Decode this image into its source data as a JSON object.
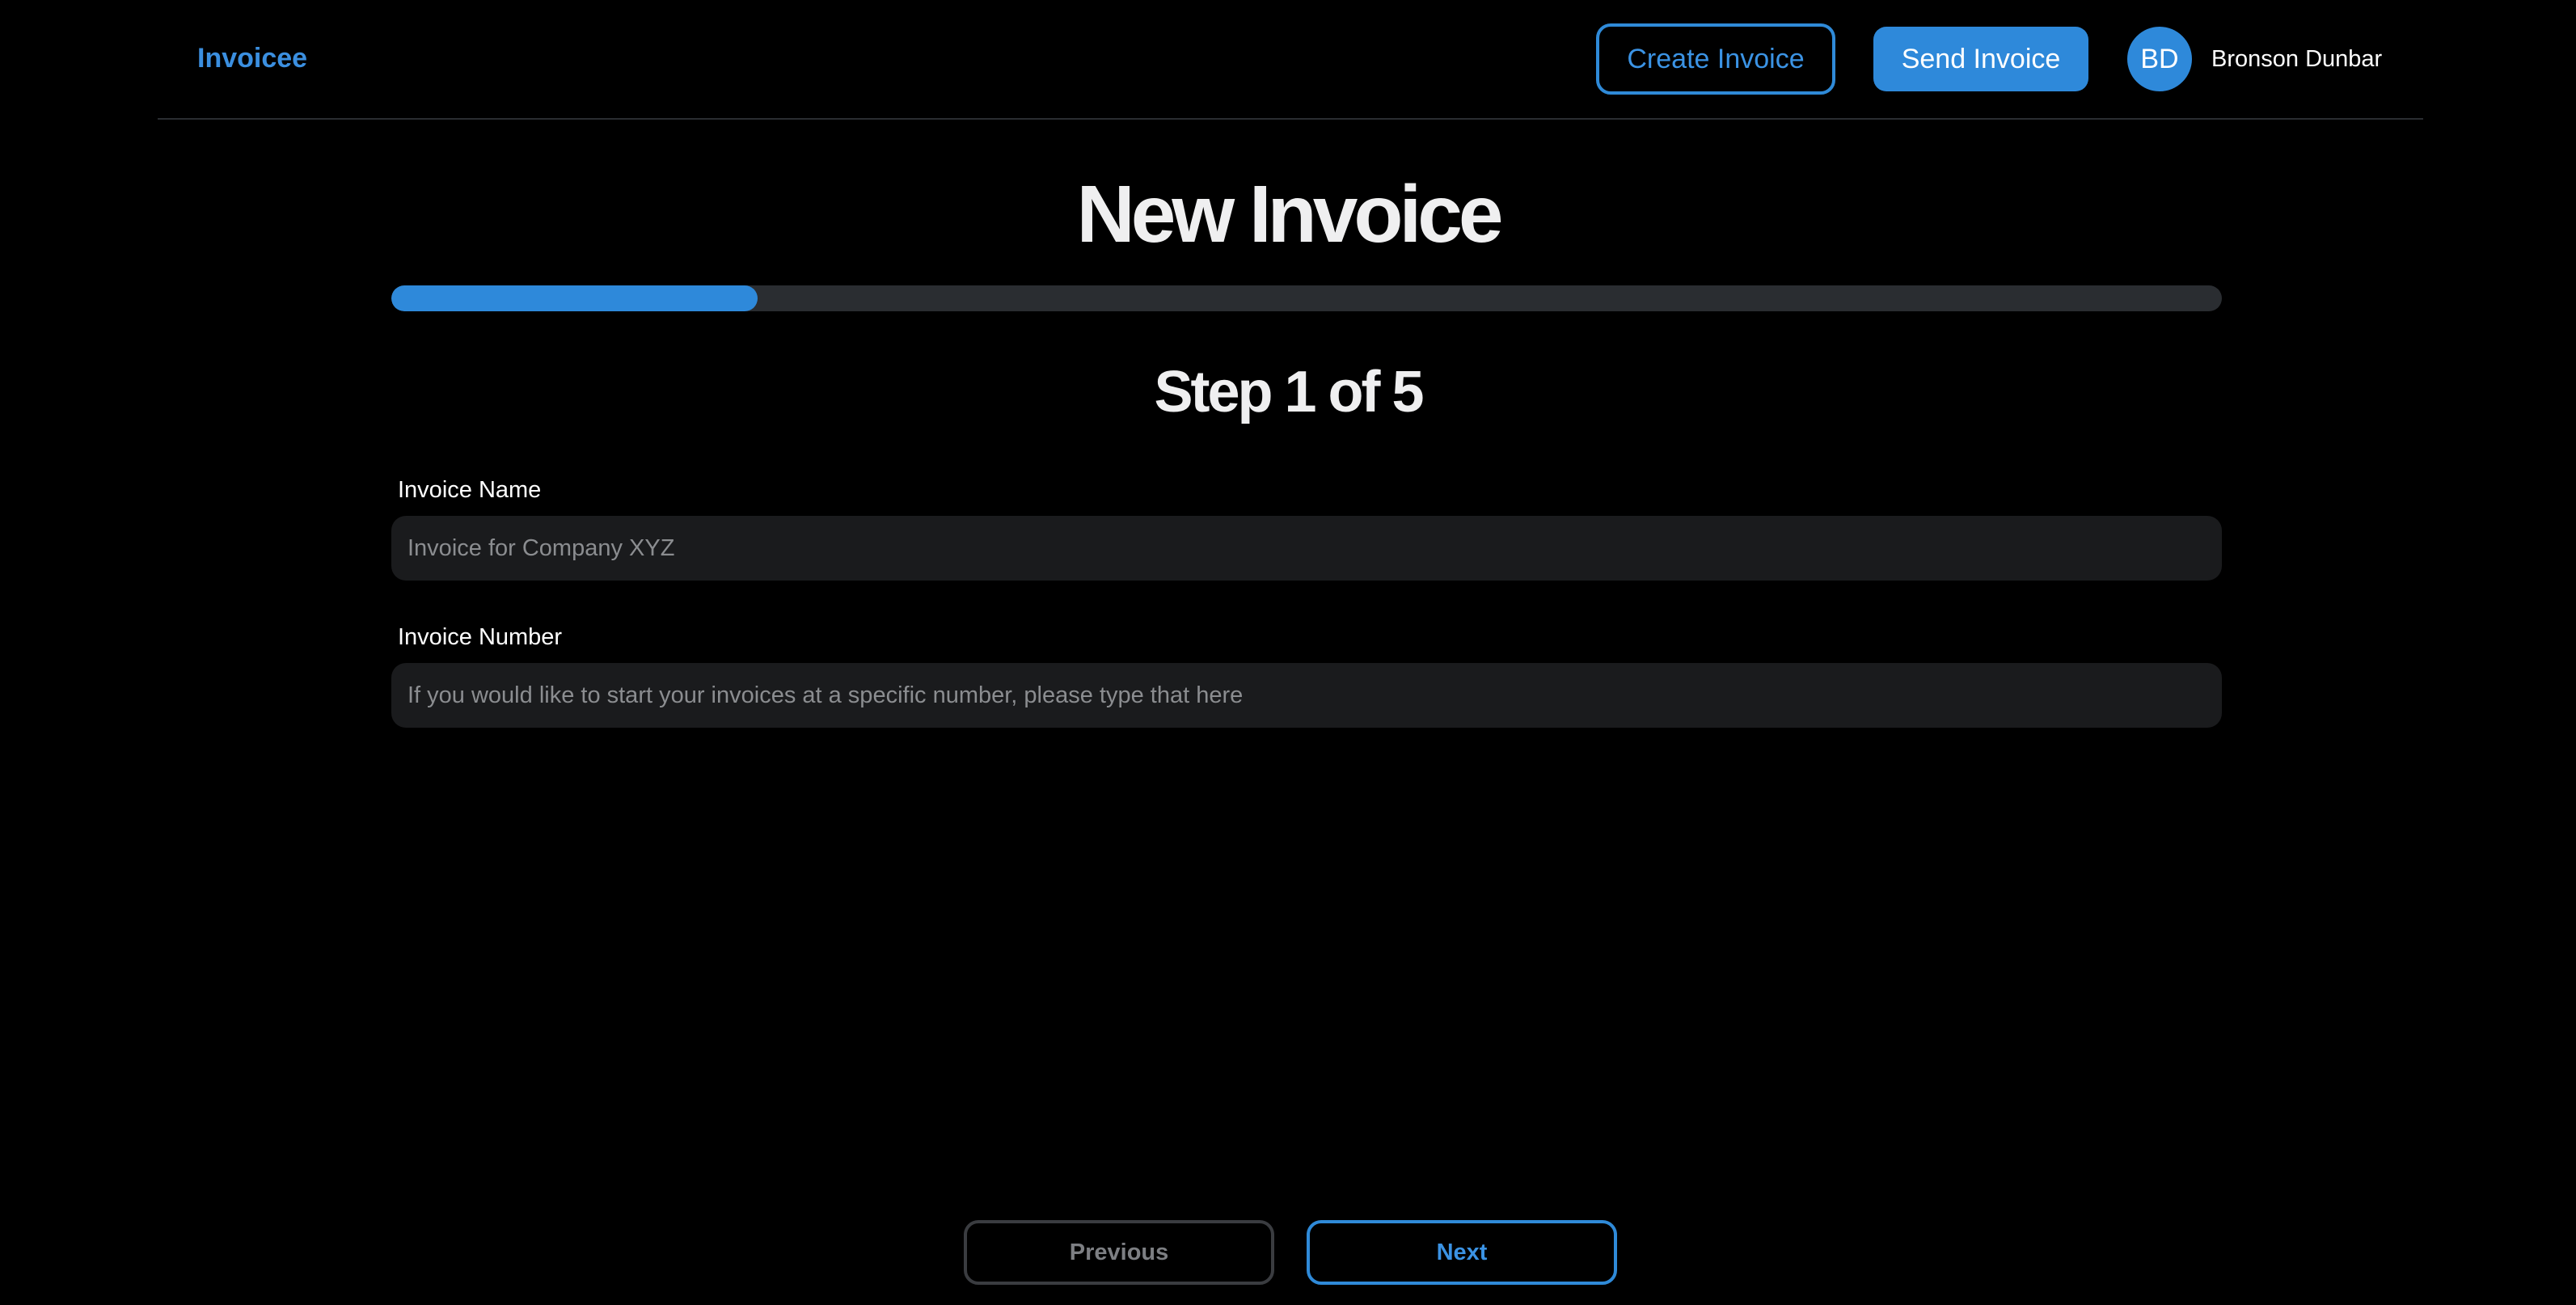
{
  "header": {
    "brand": "Invoicee",
    "create_label": "Create Invoice",
    "send_label": "Send Invoice",
    "user": {
      "initials": "BD",
      "name": "Bronson Dunbar"
    }
  },
  "main": {
    "title": "New Invoice",
    "progress": {
      "current_step": 1,
      "total_steps": 5,
      "fraction": 0.2
    },
    "step_label": "Step 1 of 5",
    "fields": [
      {
        "label": "Invoice Name",
        "value": "",
        "placeholder": "Invoice for Company XYZ"
      },
      {
        "label": "Invoice Number",
        "value": "",
        "placeholder": "If you would like to start your invoices at a specific number, please type that here"
      }
    ]
  },
  "footer": {
    "previous_label": "Previous",
    "next_label": "Next"
  },
  "colors": {
    "accent": "#2e89da",
    "background": "#000000",
    "input_bg": "#1a1b1d",
    "track": "#2a2d31",
    "disabled": "#7d7f83"
  }
}
